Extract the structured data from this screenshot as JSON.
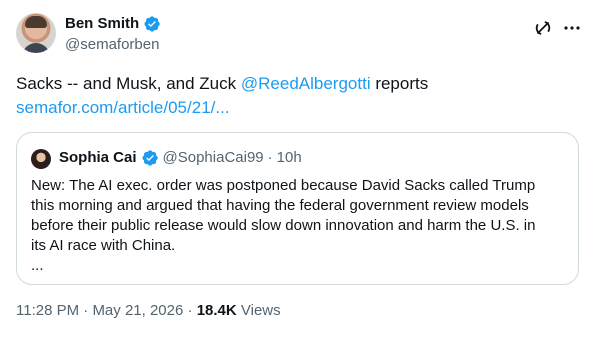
{
  "author": {
    "name": "Ben Smith",
    "handle": "@semaforben",
    "verified": true,
    "badge_color": "#1d9bf0"
  },
  "tweet": {
    "text_before_mention": "Sacks -- and Musk, and Zuck ",
    "mention": "@ReedAlbergotti",
    "text_after_mention": " reports",
    "link": "semafor.com/article/05/21/..."
  },
  "quote": {
    "name": "Sophia Cai",
    "handle": "@SophiaCai99",
    "separator": "·",
    "time": "10h",
    "verified": true,
    "text_lines": [
      "New: The AI exec. order was postponed because David Sacks called Trump",
      "this morning and argued that having the federal government review models",
      "before their public release would slow down innovation and harm the U.S. in",
      "its AI race with China.",
      "..."
    ]
  },
  "meta": {
    "time": "11:28 PM",
    "sep1": " · ",
    "date": "May 21, 2026",
    "sep2": " · ",
    "views_count": "18.4K",
    "views_label": " Views"
  },
  "icons": {
    "grok": "grok-icon",
    "more": "more-icon",
    "verified": "verified-badge-icon"
  },
  "colors": {
    "accent": "#1d9bf0",
    "text": "#0f1419",
    "secondary": "#536471",
    "border": "#cfd9de"
  }
}
